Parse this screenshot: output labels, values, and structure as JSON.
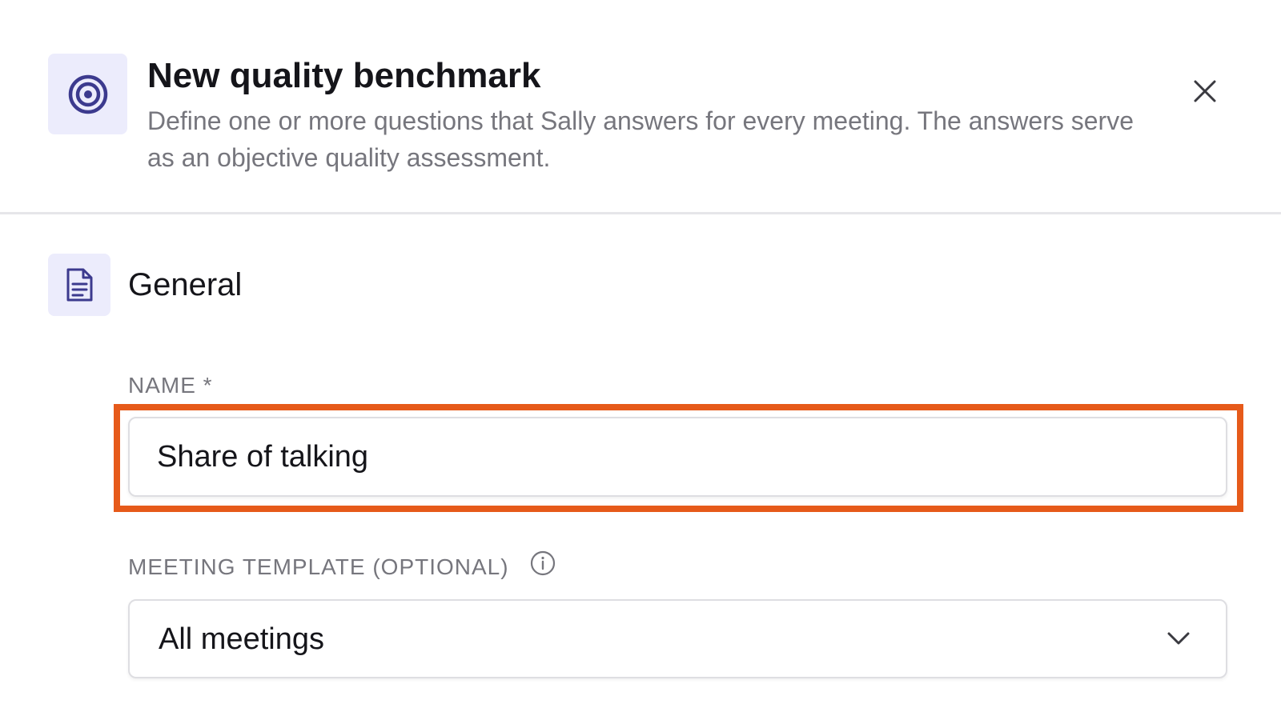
{
  "dialog": {
    "title": "New quality benchmark",
    "description": "Define one or more questions that Sally answers for every meeting. The answers serve as an objective quality assessment.",
    "header_icon": "target-icon",
    "close_icon": "close-icon"
  },
  "section": {
    "title": "General",
    "icon": "document-icon"
  },
  "fields": {
    "name": {
      "label": "NAME *",
      "value": "Share of talking"
    },
    "meeting_template": {
      "label": "MEETING TEMPLATE (OPTIONAL)",
      "info_icon": "info-icon",
      "selected": "All meetings",
      "chevron_icon": "chevron-down-icon"
    }
  },
  "colors": {
    "accent": "#3c3a8e",
    "icon_background": "#ececfc",
    "highlight": "#e65a1a",
    "muted_text": "#76767d",
    "border": "#dedee2"
  }
}
